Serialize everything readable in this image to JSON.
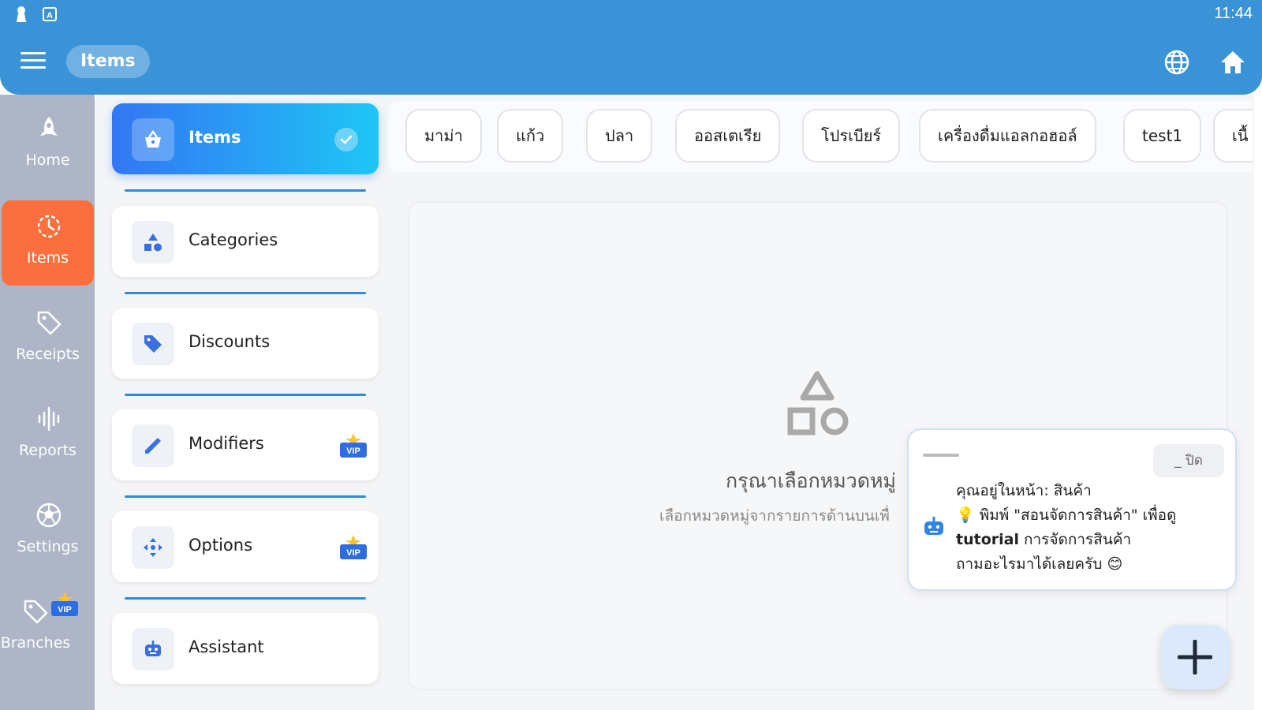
{
  "status_bar": {
    "time": "11:44"
  },
  "app_bar": {
    "title": "Items"
  },
  "rail": {
    "items": [
      {
        "label": "Home",
        "icon": "rocket-icon"
      },
      {
        "label": "Items",
        "icon": "clock-icon",
        "active": true
      },
      {
        "label": "Receipts",
        "icon": "tag-icon"
      },
      {
        "label": "Reports",
        "icon": "waveform-icon"
      },
      {
        "label": "Settings",
        "icon": "soccer-ball-icon"
      },
      {
        "label": "Branches",
        "icon": "tag-vip-icon",
        "badge": "VIP"
      }
    ]
  },
  "menu": {
    "items": [
      {
        "label": "Items",
        "icon": "basket-icon",
        "selected": true
      },
      {
        "label": "Categories",
        "icon": "shapes-icon"
      },
      {
        "label": "Discounts",
        "icon": "price-tag-icon"
      },
      {
        "label": "Modifiers",
        "icon": "pencil-icon",
        "badge": "VIP"
      },
      {
        "label": "Options",
        "icon": "move-arrows-icon",
        "badge": "VIP"
      },
      {
        "label": "Assistant",
        "icon": "robot-icon"
      }
    ],
    "vip_label": "VIP"
  },
  "categories": {
    "chips": [
      "มาม่า",
      "แก้ว",
      "ปลา",
      "ออสเตเรีย",
      "โปรเบียร์",
      "เครื่องดื่มแอลกอฮอล์",
      "test1",
      "เนื้"
    ]
  },
  "empty_state": {
    "title": "กรุณาเลือกหมวดหมู่",
    "subtitle": "เลือกหมวดหมู่จากรายการด้านบนเพื่"
  },
  "assistant_bubble": {
    "close_label": "_ ปิด",
    "line1": "คุณอยู่ในหน้า: สินค้า",
    "line2": "💡 พิมพ์ \"สอนจัดการสินค้า\" เพื่อดู",
    "line3_bold": "tutorial",
    "line3_rest": " การจัดการสินค้า",
    "line4": "ถามอะไรมาได้เลยครับ 😊"
  },
  "colors": {
    "app_bar": "#3a93d6",
    "rail_bg": "#aeb5c6",
    "rail_active": "#fb6f3e",
    "selected_gradient_start": "#3376f3",
    "selected_gradient_end": "#1ec6f5",
    "accent_icon": "#3a6fe0"
  }
}
